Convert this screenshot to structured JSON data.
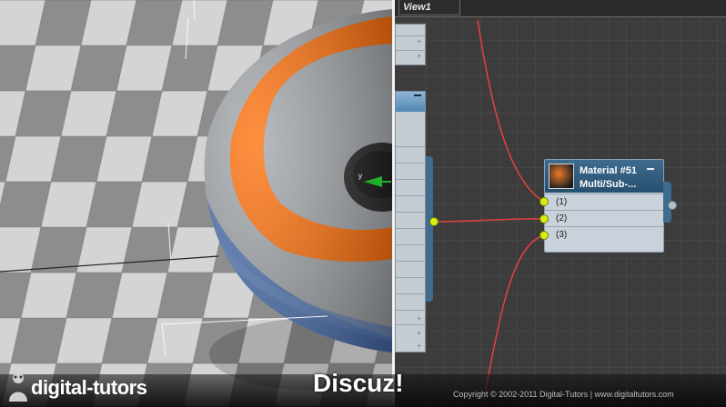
{
  "slate": {
    "view_tab": "View1",
    "node": {
      "title": "Material #51",
      "subtitle": "Multi/Sub-...",
      "slots": [
        "(1)",
        "(2)",
        "(3)"
      ]
    }
  },
  "branding": {
    "logo_text": "digital-tutors",
    "watermark": "Discuz!",
    "copyright": "Copyright © 2002-2011 Digital-Tutors  |  www.digitaltutors.com"
  },
  "colors": {
    "torus_gray": "#9fa3a8",
    "torus_orange": "#ff6a00",
    "torus_blue": "#4a6fb0",
    "wire_red": "#e84040",
    "socket_yellow": "#d8ee10",
    "node_header": "#2f5a7c"
  },
  "icons": [
    "gizmo-icon",
    "digital-tutors-logo-icon",
    "minus-icon",
    "material-thumbnail-icon"
  ]
}
